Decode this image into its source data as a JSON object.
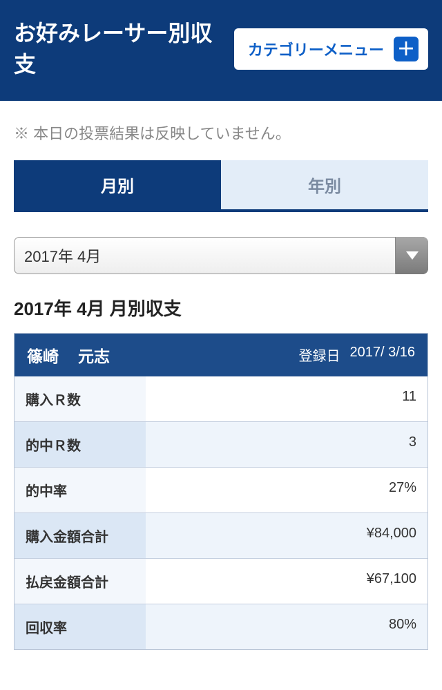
{
  "header": {
    "title": "お好みレーサー別収支",
    "category_menu_label": "カテゴリーメニュー"
  },
  "notice": "※ 本日の投票結果は反映していません。",
  "tabs": {
    "monthly": "月別",
    "yearly": "年別"
  },
  "period_select": {
    "value": "2017年 4月"
  },
  "section_title": "2017年 4月 月別収支",
  "racer": {
    "surname": "篠崎",
    "given": "元志",
    "reg_label": "登録日",
    "reg_date": "2017/ 3/16"
  },
  "rows": [
    {
      "label": "購入Ｒ数",
      "value": "11"
    },
    {
      "label": "的中Ｒ数",
      "value": "3"
    },
    {
      "label": "的中率",
      "value": "27%"
    },
    {
      "label": "購入金額合計",
      "value": "¥84,000"
    },
    {
      "label": "払戻金額合計",
      "value": "¥67,100"
    },
    {
      "label": "回収率",
      "value": "80%"
    }
  ]
}
